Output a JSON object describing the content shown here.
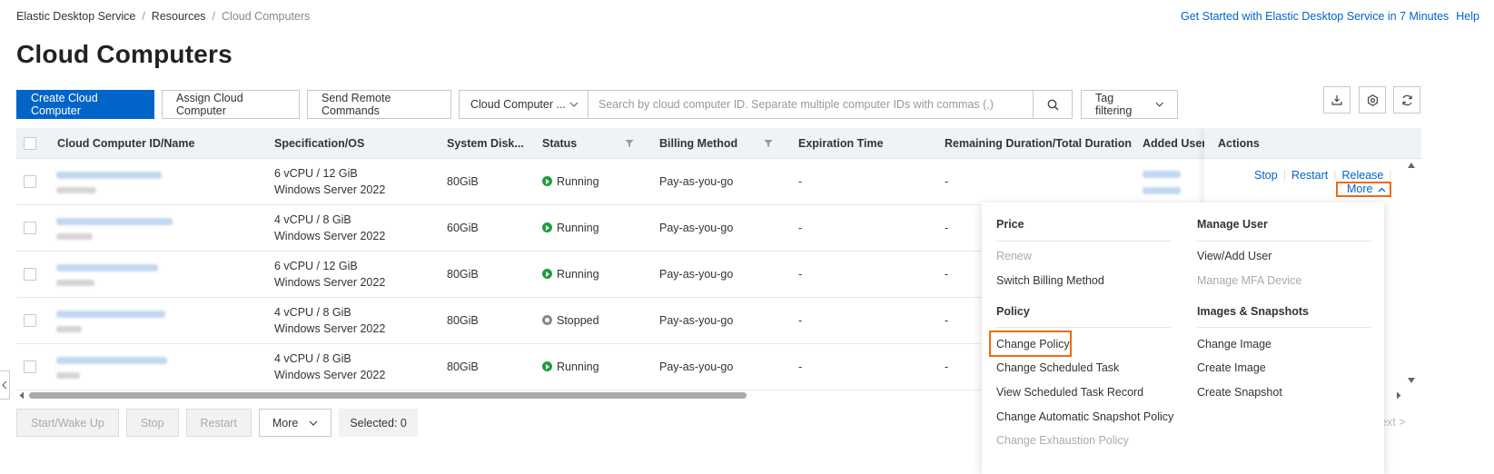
{
  "breadcrumb": {
    "items": [
      "Elastic Desktop Service",
      "Resources",
      "Cloud Computers"
    ]
  },
  "top_links": {
    "get_started": "Get Started with Elastic Desktop Service in 7 Minutes",
    "help": "Help"
  },
  "page_title": "Cloud Computers",
  "toolbar": {
    "create": "Create Cloud Computer",
    "assign": "Assign Cloud Computer",
    "send_commands": "Send Remote Commands",
    "select_value": "Cloud Computer ...",
    "search_placeholder": "Search by cloud computer ID. Separate multiple computer IDs with commas (,)",
    "tag_filtering": "Tag filtering"
  },
  "table": {
    "columns": [
      "Cloud Computer ID/Name",
      "Specification/OS",
      "System Disk...",
      "Status",
      "Billing Method",
      "Expiration Time",
      "Remaining Duration/Total Duration",
      "Added Users/",
      "Actions"
    ],
    "rows": [
      {
        "spec": "6 vCPU / 12 GiB",
        "os": "Windows Server 2022",
        "disk": "80GiB",
        "status": "Running",
        "billing": "Pay-as-you-go",
        "expiration": "-",
        "remaining": "-"
      },
      {
        "spec": "4 vCPU / 8 GiB",
        "os": "Windows Server 2022",
        "disk": "60GiB",
        "status": "Running",
        "billing": "Pay-as-you-go",
        "expiration": "-",
        "remaining": "-"
      },
      {
        "spec": "6 vCPU / 12 GiB",
        "os": "Windows Server 2022",
        "disk": "80GiB",
        "status": "Running",
        "billing": "Pay-as-you-go",
        "expiration": "-",
        "remaining": "-"
      },
      {
        "spec": "4 vCPU / 8 GiB",
        "os": "Windows Server 2022",
        "disk": "80GiB",
        "status": "Stopped",
        "billing": "Pay-as-you-go",
        "expiration": "-",
        "remaining": "-"
      },
      {
        "spec": "4 vCPU / 8 GiB",
        "os": "Windows Server 2022",
        "disk": "80GiB",
        "status": "Running",
        "billing": "Pay-as-you-go",
        "expiration": "-",
        "remaining": "-"
      }
    ]
  },
  "row_actions": {
    "stop": "Stop",
    "restart": "Restart",
    "release": "Release",
    "more": "More"
  },
  "footer": {
    "start": "Start/Wake Up",
    "stop": "Stop",
    "restart": "Restart",
    "more": "More",
    "selected": "Selected: 0",
    "next": "ext >"
  },
  "dropdown": {
    "price_title": "Price",
    "renew": "Renew",
    "switch_billing": "Switch Billing Method",
    "policy_title": "Policy",
    "change_policy": "Change Policy",
    "change_scheduled_task": "Change Scheduled Task",
    "view_scheduled_task_record": "View Scheduled Task Record",
    "change_auto_snapshot_policy": "Change Automatic Snapshot Policy",
    "change_exhaustion_policy": "Change Exhaustion Policy",
    "manage_user_title": "Manage User",
    "view_add_user": "View/Add User",
    "manage_mfa": "Manage MFA Device",
    "images_title": "Images & Snapshots",
    "change_image": "Change Image",
    "create_image": "Create Image",
    "create_snapshot": "Create Snapshot"
  },
  "colors": {
    "primary": "#0064c8",
    "highlight": "#f06a0f",
    "running": "#1d9e3c",
    "stopped": "#888888"
  }
}
